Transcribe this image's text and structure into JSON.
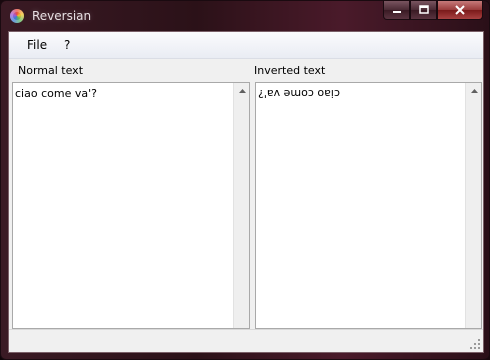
{
  "window": {
    "title": "Reversian",
    "icon": "app-color-wheel-icon",
    "controls": {
      "minimize": "minimize-icon",
      "maximize": "maximize-icon",
      "close": "close-icon"
    }
  },
  "menu": {
    "items": [
      {
        "label": "File"
      },
      {
        "label": "?"
      }
    ]
  },
  "left_panel": {
    "label": "Normal text",
    "text": "ciao come va'?"
  },
  "right_panel": {
    "label": "Inverted text",
    "text": "ciao come va'?"
  }
}
